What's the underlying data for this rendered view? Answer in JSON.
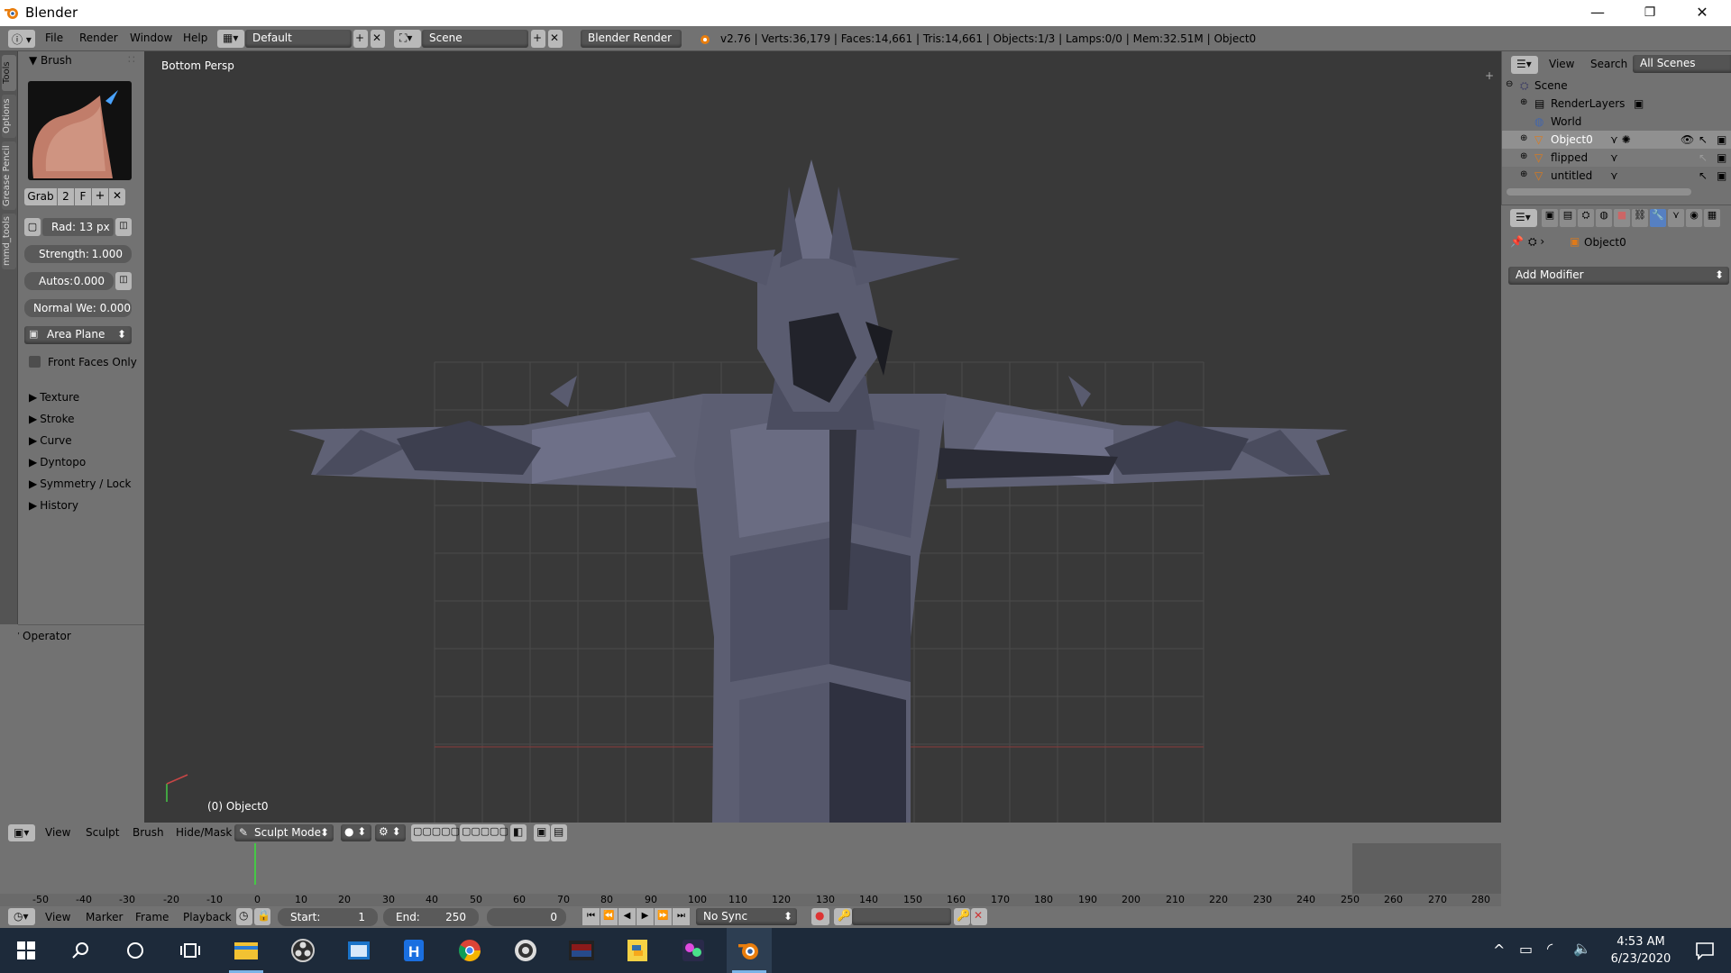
{
  "window": {
    "title": "Blender",
    "minimize": "—",
    "restore": "❐",
    "close": "✕"
  },
  "infobar": {
    "menus": [
      "File",
      "Render",
      "Window",
      "Help"
    ],
    "layout": "Default",
    "scene": "Scene",
    "engine": "Blender Render",
    "stats": "v2.76 | Verts:36,179 | Faces:14,661 | Tris:14,661 | Objects:1/3 | Lamps:0/0 | Mem:32.51M | Object0"
  },
  "lefttabs": [
    "Tools",
    "Options",
    "Grease Pencil",
    "mmd_tools"
  ],
  "toolpanel": {
    "brush_header": "Brush",
    "brush_name": "Grab",
    "brush_users": "2",
    "brush_fake": "F",
    "radius": "Rad: 13 px",
    "strength_label": "Strength:",
    "strength_value": "1.000",
    "autos_label": "Autos:",
    "autos_value": "0.000",
    "normal": "Normal We: 0.000",
    "plane": "Area Plane",
    "front_faces": "Front Faces Only",
    "subpanels": [
      "Texture",
      "Stroke",
      "Curve",
      "Dyntopo",
      "Symmetry / Lock",
      "History"
    ],
    "operator": "Operator"
  },
  "viewport": {
    "view_label": "Bottom Persp",
    "object_label": "(0) Object0"
  },
  "vhdr": {
    "menus": [
      "View",
      "Sculpt",
      "Brush",
      "Hide/Mask"
    ],
    "mode": "Sculpt Mode"
  },
  "timeline": {
    "ticks": [
      "-50",
      "-40",
      "-30",
      "-20",
      "-10",
      "0",
      "10",
      "20",
      "30",
      "40",
      "50",
      "60",
      "70",
      "80",
      "90",
      "100",
      "110",
      "120",
      "130",
      "140",
      "150",
      "160",
      "170",
      "180",
      "190",
      "200",
      "210",
      "220",
      "230",
      "240",
      "250",
      "260",
      "270",
      "280"
    ],
    "current_frame": 0
  },
  "tbar": {
    "menus": [
      "View",
      "Marker",
      "Frame",
      "Playback"
    ],
    "start_label": "Start:",
    "start": "1",
    "end_label": "End:",
    "end": "250",
    "current": "0",
    "sync": "No Sync"
  },
  "outliner": {
    "menus": [
      "View",
      "Search"
    ],
    "filter": "All Scenes",
    "items": [
      {
        "label": "Scene"
      },
      {
        "label": "RenderLayers"
      },
      {
        "label": "World"
      },
      {
        "label": "Object0"
      },
      {
        "label": "flipped"
      },
      {
        "label": "untitled"
      }
    ]
  },
  "properties": {
    "object": "Object0",
    "add_modifier": "Add Modifier"
  },
  "taskbar": {
    "time": "4:53 AM",
    "date": "6/23/2020"
  },
  "colors": {
    "accent": "#5680c2",
    "viewport_bg": "#393939",
    "panel": "#727272",
    "taskbar": "#1d2a3a",
    "frame_marker": "#46c846"
  }
}
